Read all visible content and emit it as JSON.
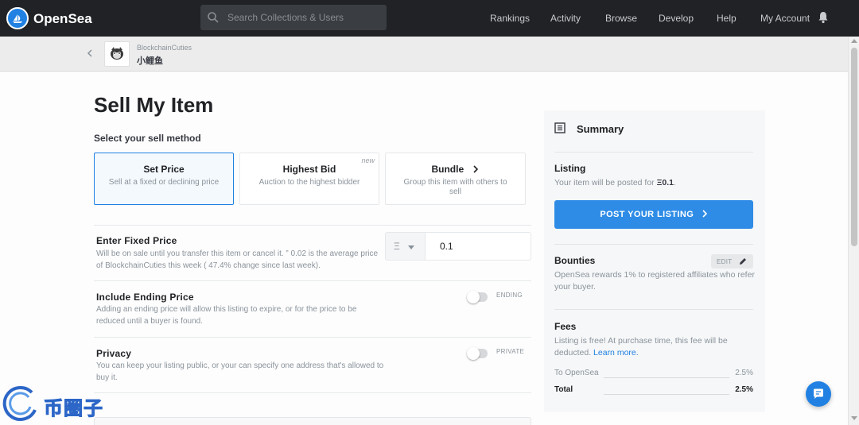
{
  "navbar": {
    "brand": "OpenSea",
    "search_placeholder": "Search Collections & Users",
    "links": [
      "Rankings",
      "Activity",
      "Browse",
      "Develop",
      "Help",
      "My Account"
    ]
  },
  "breadcrumb": {
    "collection": "BlockchainCuties",
    "item": "小鲤鱼"
  },
  "page": {
    "title": "Sell My Item",
    "method_heading": "Select your sell method"
  },
  "methods": [
    {
      "title": "Set Price",
      "desc": "Sell at a fixed or declining price",
      "badge": ""
    },
    {
      "title": "Highest Bid",
      "desc": "Auction to the highest bidder",
      "badge": "new"
    },
    {
      "title": "Bundle",
      "desc": "Group this item with others to sell",
      "badge": ""
    }
  ],
  "fixed_price": {
    "title": "Enter Fixed Price",
    "desc": "Will be on sale until you transfer this item or cancel it. ” 0.02 is the average price of BlockchainCuties this week ( 47.4% change since last week).",
    "currency_symbol": "Ξ",
    "value": "0.1"
  },
  "ending_price": {
    "title": "Include Ending Price",
    "desc": "Adding an ending price will allow this listing to expire, or for the price to be reduced until a buyer is found.",
    "toggle_label": "ENDING"
  },
  "privacy": {
    "title": "Privacy",
    "desc": "You can keep your listing public, or your can specify one address that's allowed to buy it.",
    "toggle_label": "PRIVATE"
  },
  "summary": {
    "title": "Summary",
    "listing_title": "Listing",
    "listing_text": "Your item will be posted for ",
    "listing_price": "Ξ0.1",
    "listing_suffix": ".",
    "post_button": "POST YOUR LISTING",
    "bounties_title": "Bounties",
    "edit_label": "EDIT",
    "bounties_text": "OpenSea rewards 1% to registered affiliates who refer your buyer.",
    "fees_title": "Fees",
    "fees_text": "Listing is free! At purchase time, this fee will be deducted. ",
    "learn_more": "Learn more.",
    "fees": [
      {
        "label": "To OpenSea",
        "value": "2.5%"
      },
      {
        "label": "Total",
        "value": "2.5%"
      }
    ]
  },
  "watermark": {
    "text": "币圈子"
  },
  "colors": {
    "accent": "#2081e2",
    "navbar": "#202225",
    "button": "#2e8ce6"
  }
}
